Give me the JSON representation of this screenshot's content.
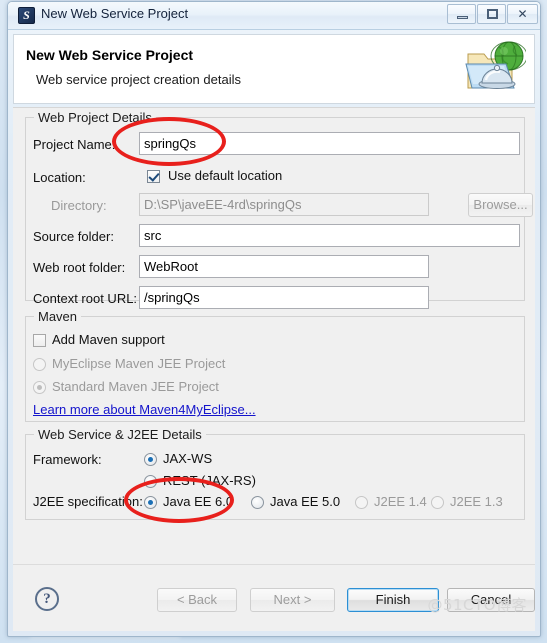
{
  "window": {
    "title": "New Web Service Project",
    "icon": "myeclipse-icon",
    "controls": {
      "minimize": "–",
      "maximize": "❐",
      "close": "✕"
    }
  },
  "header": {
    "title": "New Web Service Project",
    "subtitle": "Web service project creation details",
    "icon": "web-service-folder-globe-icon"
  },
  "web_project_details": {
    "group_title": "Web Project Details",
    "project_name_label": "Project Name:",
    "project_name_value": "springQs",
    "location_label": "Location:",
    "use_default_location_label": "Use default location",
    "use_default_location_checked": true,
    "directory_label": "Directory:",
    "directory_value": "D:\\SP\\javeEE-4rd\\springQs",
    "browse_label": "Browse...",
    "source_folder_label": "Source folder:",
    "source_folder_value": "src",
    "web_root_label": "Web root folder:",
    "web_root_value": "WebRoot",
    "context_root_label": "Context root URL:",
    "context_root_value": "/springQs"
  },
  "maven": {
    "group_title": "Maven",
    "add_maven_support_label": "Add Maven support",
    "add_maven_support_checked": false,
    "options": [
      {
        "label": "MyEclipse Maven JEE Project",
        "selected": false,
        "disabled": true
      },
      {
        "label": "Standard Maven JEE Project",
        "selected": true,
        "disabled": true
      }
    ],
    "learn_more_link": "Learn more about Maven4MyEclipse..."
  },
  "web_service_j2ee": {
    "group_title": "Web Service & J2EE Details",
    "framework_label": "Framework:",
    "frameworks": [
      {
        "label": "JAX-WS",
        "selected": true,
        "disabled": false
      },
      {
        "label": "REST (JAX-RS)",
        "selected": false,
        "disabled": false
      }
    ],
    "j2ee_spec_label": "J2EE specification:",
    "j2ee_specs": [
      {
        "label": "Java EE 6.0",
        "selected": true,
        "disabled": false
      },
      {
        "label": "Java EE 5.0",
        "selected": false,
        "disabled": false
      },
      {
        "label": "J2EE 1.4",
        "selected": false,
        "disabled": true
      },
      {
        "label": "J2EE 1.3",
        "selected": false,
        "disabled": true
      }
    ]
  },
  "buttons": {
    "help": "?",
    "back": "< Back",
    "next": "Next >",
    "finish": "Finish",
    "cancel": "Cancel"
  },
  "watermark": "@51CTO博客"
}
